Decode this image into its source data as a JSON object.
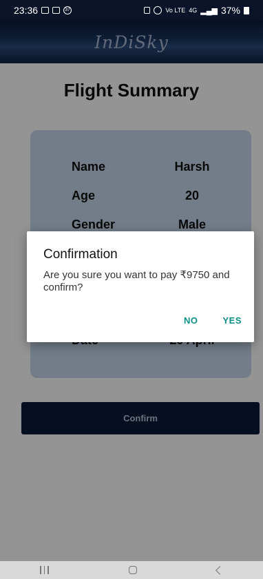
{
  "status_bar": {
    "time": "23:36",
    "notif_badge": "37",
    "net_label": "Vo LTE",
    "net_label2": "4G",
    "battery": "37%"
  },
  "header": {
    "brand": "InDiSky"
  },
  "page": {
    "title": "Flight Summary",
    "details": [
      {
        "label": "Name",
        "value": "Harsh"
      },
      {
        "label": "Age",
        "value": "20"
      },
      {
        "label": "Gender",
        "value": "Male"
      },
      {
        "label": "Date",
        "value": "20 April"
      }
    ],
    "confirm_label": "Confirm"
  },
  "dialog": {
    "title": "Confirmation",
    "message": "Are you sure you want to pay ₹9750 and confirm?",
    "no_label": "NO",
    "yes_label": "YES"
  },
  "nav": {
    "recents_icon": "recents-icon",
    "home_icon": "home-icon",
    "back_icon": "back-icon"
  },
  "colors": {
    "header_bg": "#0c1d3a",
    "card_bg": "#c4d7ec",
    "confirm_bg": "#0a1b3a",
    "dialog_action": "#0a8f86"
  }
}
